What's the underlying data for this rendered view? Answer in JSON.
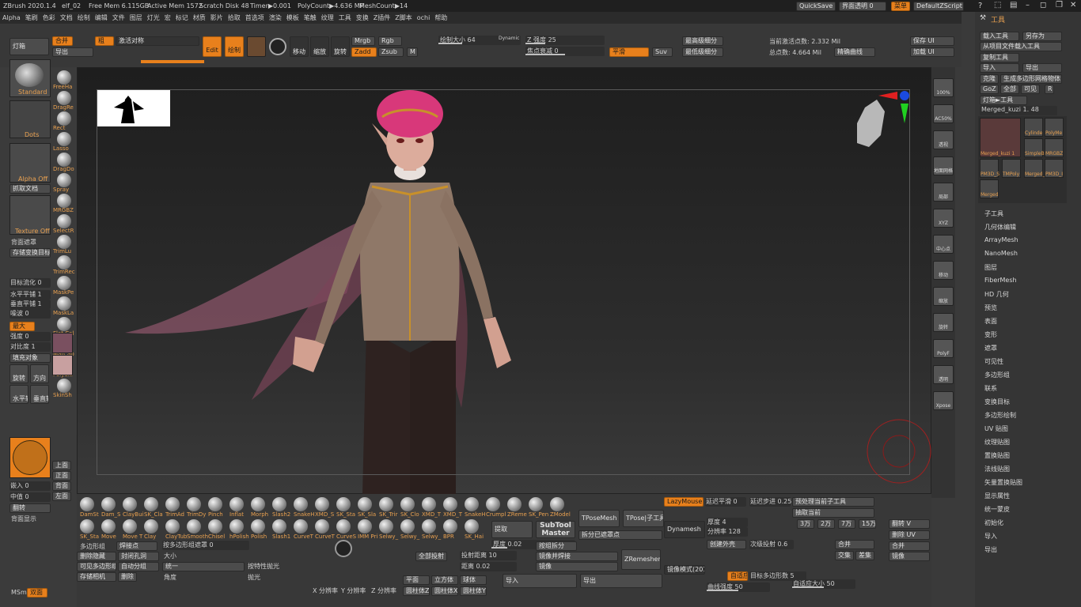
{
  "titlebar": {
    "app": "ZBrush 2020.1.4",
    "doc": "elf_02",
    "freemem": "Free Mem 6.115GB",
    "activemem": "Active Mem 1572",
    "scratch": "Scratch Disk 48",
    "timer": "Timer▶0.001",
    "polycount": "PolyCount▶4.636 MP",
    "meshcount": "MeshCount▶14",
    "quicksave": "QuickSave",
    "transparency": "界面透明 0",
    "menu": "菜单",
    "script": "DefaultZScript"
  },
  "menubar": [
    "Alpha",
    "笔刷",
    "色彩",
    "文档",
    "绘制",
    "编辑",
    "文件",
    "图层",
    "灯光",
    "宏",
    "标记",
    "材质",
    "影片",
    "拾取",
    "首选项",
    "渲染",
    "模板",
    "笔触",
    "纹理",
    "工具",
    "变换",
    "Z插件",
    "Z脚本",
    "ochi",
    "帮助"
  ],
  "toptool": {
    "lightbox": "灯箱",
    "merge": "合并",
    "export": "导出",
    "brush_label": "粗",
    "activate_sym": "激活对称",
    "edit": "Edit",
    "draw": "绘制",
    "move": "移动",
    "scale": "缩放",
    "rotate": "旋转",
    "mrgb": "Mrgb",
    "rgb": "Rgb",
    "m": "M",
    "zadd": "Zadd",
    "zsub": "Zsub",
    "draw_size": "绘制大小 64",
    "dynamic": "Dynamic",
    "z_intensity": "Z 强度 25",
    "focal_shift": "焦点衰减 0",
    "smooth": "平滑",
    "suv": "Suv",
    "higher_sub": "最高级细分",
    "lower_sub": "最低级细分",
    "active_points": "当前激活点数: 2.332 Mil",
    "total_points": "总点数: 4.664 Mil",
    "curve": "精确曲线",
    "save_ui": "保存 UI",
    "load_ui": "加载 UI"
  },
  "leftpanel": {
    "standard": "Standard",
    "dots": "Dots",
    "alpha_off": "Alpha Off",
    "grab_doc": "抓取文档",
    "texture_off": "Texture Off",
    "backface": "背面遮罩",
    "store_morph": "存储变换目标",
    "gradient": "目标流化 0",
    "hfill": "水平平铺 1",
    "vfill": "垂直平铺 1",
    "noise": "噪波 0",
    "max": "最大",
    "intensity": "强度 0",
    "contrast": "对比度 1",
    "fill_obj": "填充对象",
    "rotate": "旋转",
    "dir": "方向",
    "hflip": "水平转",
    "vflip": "垂直转",
    "embed": "嵌入 0",
    "mid": "中值 0",
    "flip": "翻转",
    "back_show": "背面显示",
    "msm": "MSm",
    "double": "双面",
    "brushes": [
      "FreeHa",
      "DragRe",
      "Rect",
      "Lasso",
      "DragDo",
      "Spray",
      "MRGBZ",
      "SelectR",
      "TrimLu",
      "TrimRec",
      "MaskPe",
      "MaskLa",
      "Flat Col",
      "MatCap",
      "PolySki",
      "SkinSh"
    ],
    "colors": [
      "#7a5060",
      "#c8a0a0"
    ],
    "views": [
      "上面",
      "正面",
      "背面",
      "左面"
    ]
  },
  "bottom": {
    "brushes1": [
      "DamSt",
      "Dam_S",
      "ClayBui",
      "SK_Cla",
      "TrimAd",
      "TrimDy",
      "Pinch",
      "Inflat",
      "Morph",
      "Slash2",
      "SnakeH",
      "XMD_S",
      "SK_Sta",
      "SK_Sla",
      "SK_Trir",
      "SK_Clo",
      "XMD_T",
      "XMD_T",
      "SnakeH",
      "Crumpl",
      "ZReme",
      "SK_Pen",
      "ZModel"
    ],
    "brushes2": [
      "SK_Sta",
      "Move",
      "Move T",
      "Clay",
      "ClayTub",
      "Smooth",
      "Chisel",
      "hPolish",
      "Polish",
      "Slash1",
      "CurveT",
      "CurveT",
      "CurveS",
      "IMM Pri",
      "Selwy_",
      "Selwy_",
      "Selwy_",
      "BPR",
      "SK_Hai"
    ],
    "extract": "提取",
    "subtool_master": "SubTool Master",
    "tposemesh": "TPoseMesh",
    "tpose_sub": "TPose|子工具",
    "split_unmasked": "拆分已遮罩点",
    "thickness": "厚度 0.02",
    "group_split": "按组拆分",
    "dynamesh": "Dynamesh",
    "mirror_weld": "镜像并焊接",
    "mirror": "镜像",
    "zremesher": "ZRemesher",
    "all_proj": "全部投射",
    "proj_dist": "投射距离 10",
    "distance": "距离 0.02",
    "import": "导入",
    "export": "导出",
    "plane": "平面",
    "cube": "立方体",
    "sphere": "球体",
    "cyl_z": "圆柱体Z",
    "cyl_x": "圆柱体X",
    "cyl_y": "圆柱体Y",
    "x_res": "X 分辨率",
    "y_res": "Y 分辨率",
    "z_res": "Z 分辨率",
    "lazymouse": "LazyMouse",
    "lazy_smooth": "延迟平滑 0",
    "lazy_step": "延迟步进 0.25",
    "preproc": "预处理当前子工具",
    "extract_current": "抽取当前",
    "thickness4": "厚度 4",
    "res128": "分辨率 128",
    "create_shell": "创建外壳",
    "sub_proj": "次级投射 0.6",
    "merge": "合并",
    "intersect": "交集",
    "diff": "差集",
    "adaptive": "自适应",
    "target_poly": "目标多边形数 5",
    "curve_strength": "曲线强度 50",
    "adapt_size": "自适应大小 50",
    "counts": [
      "3万",
      "2万",
      "7万",
      "15万"
    ],
    "flip_v": "翻转 V",
    "delete_uv": "删除 UV",
    "merge2": "合并",
    "mirror2": "镜像",
    "group_poly": "多边形组",
    "weld_point": "焊接点",
    "hide_mask": "删除隐藏",
    "close_holes": "封闭孔洞",
    "visible_poly": "可见多边形组",
    "auto_group": "自动分组",
    "store_morph": "存储相机",
    "delete": "删除",
    "weld_sub": "按多边形组遮罩 0",
    "size_l": "大小",
    "unified": "统一",
    "polish_feat": "按特性抛光",
    "angle": "角度",
    "polish": "抛光",
    "paired": "镜像模式(2018)"
  },
  "rightpanel": {
    "header": "工具",
    "load": "载入工具",
    "save_as": "另存为",
    "load_from_proj": "从项目文件载入工具",
    "copy_tool": "复制工具",
    "import": "导入",
    "export": "导出",
    "clone": "克隆",
    "make_polymesh": "生成多边形网格物体",
    "goz": "GoZ",
    "all": "全部",
    "visible": "可见",
    "r": "R",
    "lightbox_tool": "灯箱►工具",
    "current_tool": "Merged_kuzi 1. 48",
    "tools": [
      "Merged_kuzi 1",
      "Cylinde",
      "PolyMe",
      "SimpleB",
      "MRGBZ",
      "PM3D_S",
      "TMPoly",
      "Merged_",
      "PM3D_I",
      "Merged"
    ],
    "sections": [
      "子工具",
      "几何体编辑",
      "ArrayMesh",
      "NanoMesh",
      "图层",
      "FiberMesh",
      "HD 几何",
      "预览",
      "表面",
      "变形",
      "遮罩",
      "可见性",
      "多边形组",
      "联系",
      "变换目标",
      "多边形绘制",
      "UV 贴图",
      "纹理贴图",
      "置换贴图",
      "法线贴图",
      "矢量置换贴图",
      "显示属性",
      "统一蒙皮",
      "初始化",
      "导入",
      "导出"
    ]
  },
  "shelf": [
    "100%",
    "AC50%",
    "透视",
    "地面网格",
    "局部",
    "XYZ",
    "中心点",
    "移动",
    "缩放",
    "旋转",
    "PolyF",
    "透明",
    "Xpose"
  ],
  "colors": {
    "accent": "#e8801c",
    "bg": "#3a3a3a",
    "viewport": "#1e1e1e"
  }
}
